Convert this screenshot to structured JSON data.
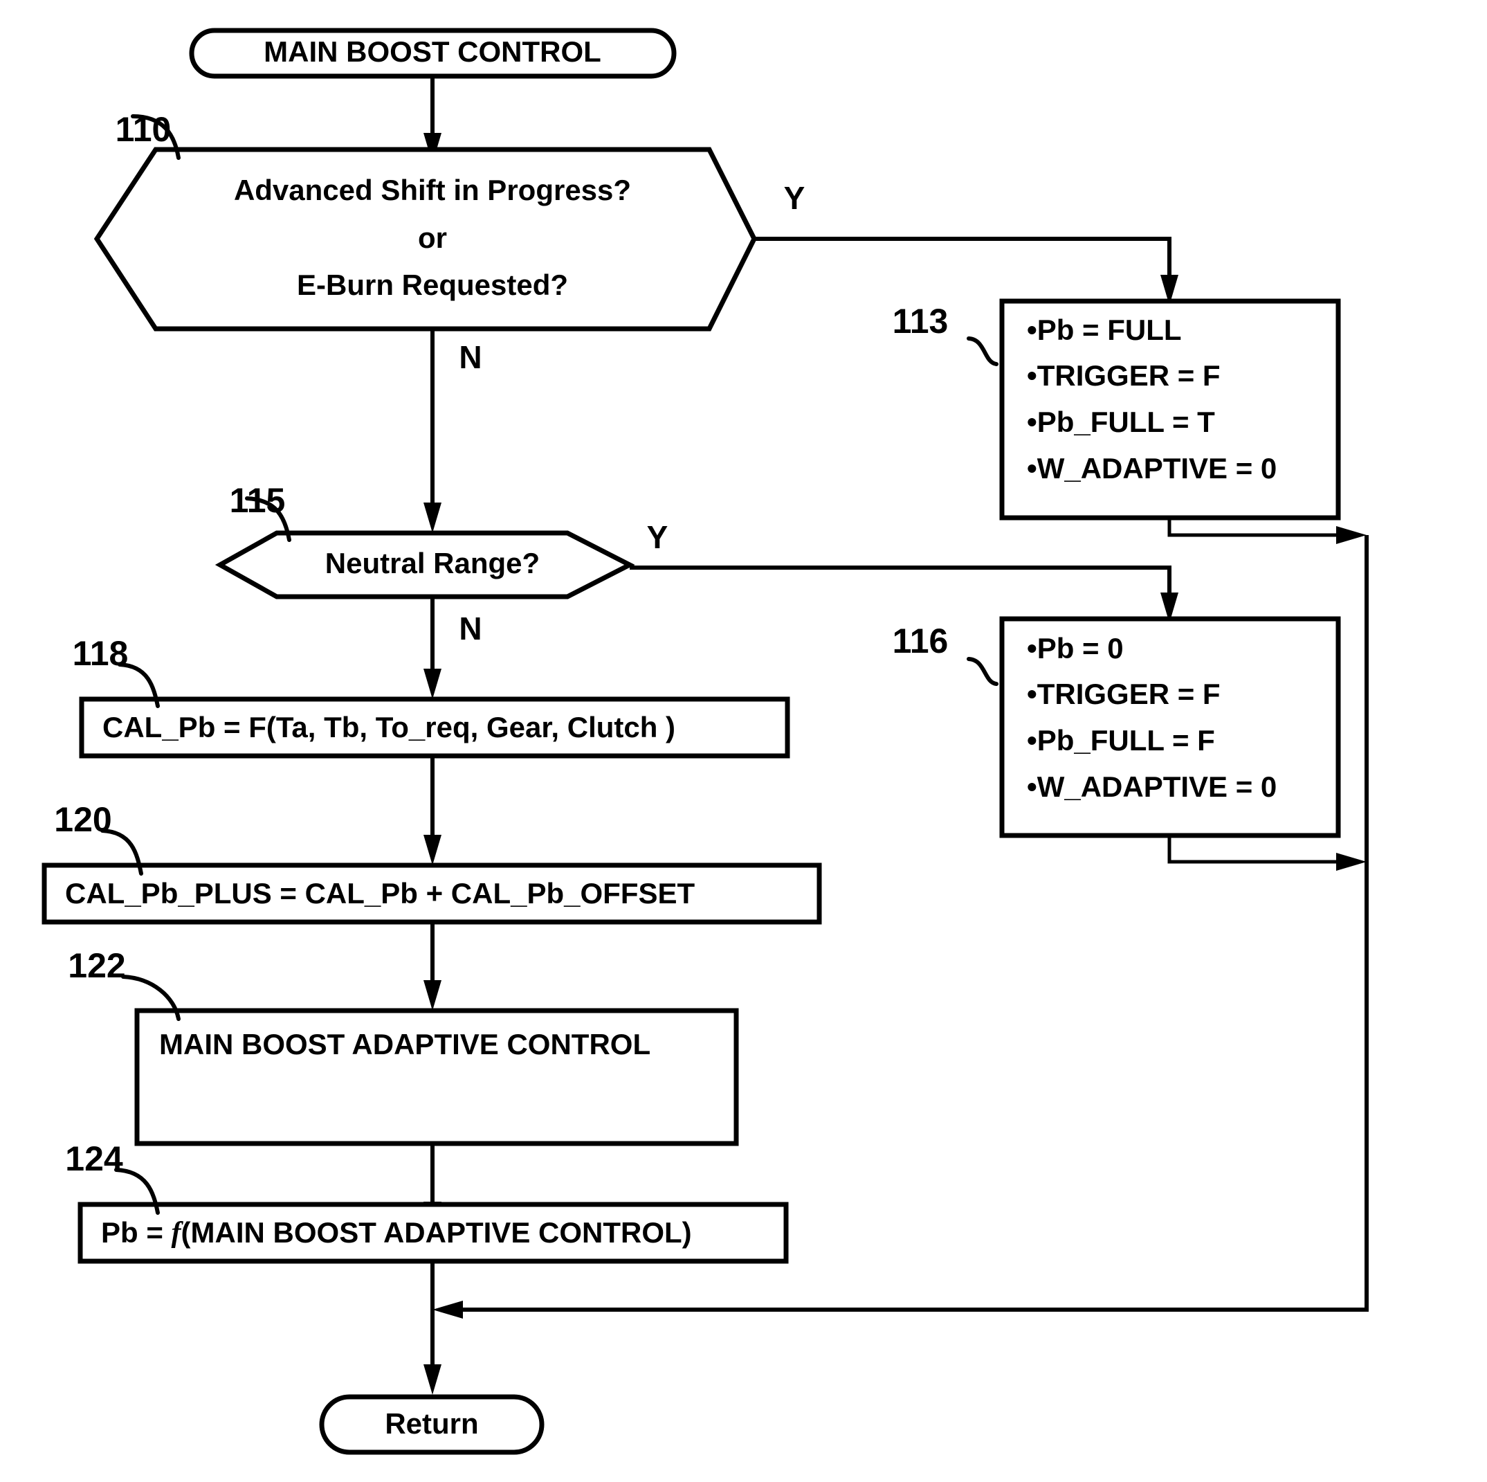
{
  "figure": {
    "type": "flowchart",
    "title": "MAIN BOOST CONTROL"
  },
  "nodes": {
    "start": {
      "ref": "",
      "shape": "terminator",
      "label": "MAIN BOOST CONTROL"
    },
    "decision_110": {
      "ref": "110",
      "shape": "hexagon",
      "line1": "Advanced Shift in Progress?",
      "line2": "or",
      "line3": "E-Burn Requested?",
      "yes_label": "Y",
      "no_label": "N"
    },
    "process_113": {
      "ref": "113",
      "shape": "rectangle",
      "bullets": [
        "•Pb = FULL",
        "•TRIGGER = F",
        "•Pb_FULL = T",
        "•W_ADAPTIVE = 0"
      ]
    },
    "decision_115": {
      "ref": "115",
      "shape": "hexagon",
      "label": "Neutral Range?",
      "yes_label": "Y",
      "no_label": "N"
    },
    "process_116": {
      "ref": "116",
      "shape": "rectangle",
      "bullets": [
        "•Pb = 0",
        "•TRIGGER = F",
        "•Pb_FULL = F",
        "•W_ADAPTIVE = 0"
      ]
    },
    "process_118": {
      "ref": "118",
      "shape": "rectangle",
      "label": "CAL_Pb = F(Ta, Tb, To_req, Gear, Clutch )"
    },
    "process_120": {
      "ref": "120",
      "shape": "rectangle",
      "label": "CAL_Pb_PLUS = CAL_Pb + CAL_Pb_OFFSET"
    },
    "process_122": {
      "ref": "122",
      "shape": "rectangle",
      "label": "MAIN BOOST ADAPTIVE CONTROL"
    },
    "process_124": {
      "ref": "124",
      "shape": "rectangle",
      "label_prefix": "Pb = ",
      "label_italic": "f",
      "label_suffix": "(MAIN BOOST ADAPTIVE CONTROL)"
    },
    "end": {
      "ref": "",
      "shape": "terminator",
      "label": "Return"
    }
  },
  "colors": {
    "stroke": "#000000",
    "fill": "#ffffff",
    "background": "#ffffff"
  }
}
